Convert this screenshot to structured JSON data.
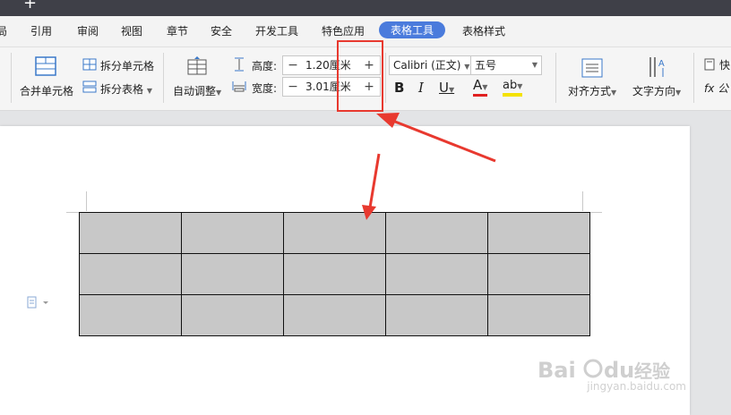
{
  "tabs": {
    "items": [
      "局",
      "引用",
      "审阅",
      "视图",
      "章节",
      "安全",
      "开发工具",
      "特色应用",
      "表格工具",
      "表格样式"
    ]
  },
  "ribbon": {
    "merge_cells": "合并单元格",
    "split_cells": "拆分单元格",
    "split_table": "拆分表格",
    "auto_fit": "自动调整",
    "height_label": "高度:",
    "height_value": "1.20厘米",
    "width_label": "宽度:",
    "width_value": "3.01厘米",
    "font_name": "Calibri (正文)",
    "font_size": "五号",
    "bold": "B",
    "italic": "I",
    "underline": "U",
    "font_color": "A",
    "highlight": "ab",
    "align": "对齐方式",
    "text_direction": "文字方向",
    "quick_calc": "快",
    "formula": "fx 公"
  },
  "table": {
    "rows": 3,
    "cols": 5,
    "cell_color": "#c8c8c8"
  },
  "watermark": {
    "logo": "Baidu经验",
    "url": "jingyan.baidu.com"
  },
  "colors": {
    "accent": "#4a7bdc",
    "annotation": "#e8392f"
  }
}
